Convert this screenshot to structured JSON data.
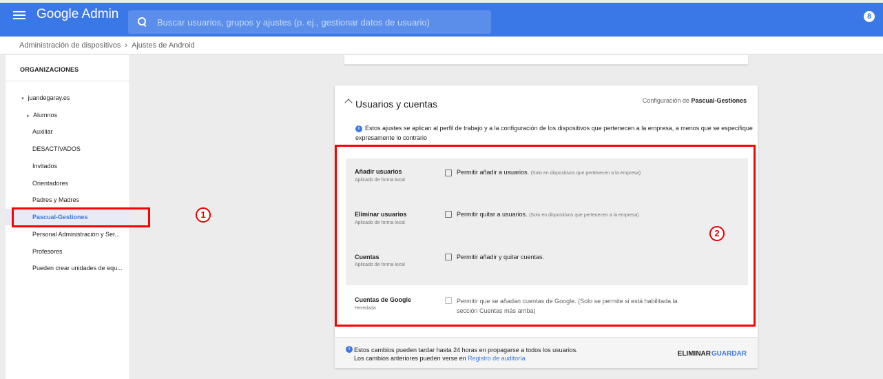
{
  "header": {
    "brand": "Google Admin",
    "search_placeholder": "Buscar usuarios, grupos y ajustes (p. ej., gestionar datos de usuario)",
    "account_initial": "8"
  },
  "breadcrumb": {
    "items": [
      "Administración de dispositivos",
      "Ajustes de Android"
    ],
    "separator": "›"
  },
  "sidebar": {
    "title": "ORGANIZACIONES",
    "items": [
      {
        "label": "juandegaray.es",
        "caret": "▾"
      },
      {
        "label": "Alumnos",
        "caret": "▸"
      },
      {
        "label": "Auxiliar"
      },
      {
        "label": "DESACTIVADOS"
      },
      {
        "label": "Invitados"
      },
      {
        "label": "Orientadores"
      },
      {
        "label": "Padres y Madres"
      },
      {
        "label": "Pascual-Gestiones",
        "selected": true
      },
      {
        "label": "Personal Administración y Ser..."
      },
      {
        "label": "Profesores"
      },
      {
        "label": "Pueden crear unidades de equ..."
      }
    ]
  },
  "markers": {
    "one": "1",
    "two": "2"
  },
  "section": {
    "title": "Usuarios y cuentas",
    "config_prefix": "Configuración de",
    "config_org": "Pascual-Gestiones",
    "info_text": "Estos ajustes se aplican al perfil de trabajo y a la configuración de los dispositivos que pertenecen a la empresa, a menos que se especifique expresamente lo contrario",
    "settings": [
      {
        "name": "Añadir usuarios",
        "sub": "Aplicado de forma local",
        "label": "Permitir añadir a usuarios.",
        "note": "(Solo en dispositivos que pertenecen a la empresa)"
      },
      {
        "name": "Eliminar usuarios",
        "sub": "Aplicado de forma local",
        "label": "Permitir quitar a usuarios.",
        "note": "(Solo en dispositivos que pertenecen a la empresa)"
      },
      {
        "name": "Cuentas",
        "sub": "Aplicado de forma local",
        "label": "Permitir añadir y quitar cuentas.",
        "note": ""
      }
    ],
    "google_accounts": {
      "name": "Cuentas de Google",
      "sub": "Heredada",
      "label": "Permitir que se añadan cuentas de Google. (Solo se permite si está habilitada la sección Cuentas más arriba)"
    }
  },
  "footer": {
    "line1": "Estos cambios pueden tardar hasta 24 horas en propagarse a todos los usuarios.",
    "line2_prefix": "Los cambios anteriores pueden verse en",
    "audit_link": "Registro de auditoría",
    "delete_label": "ELIMINAR",
    "save_label": "GUARDAR"
  }
}
